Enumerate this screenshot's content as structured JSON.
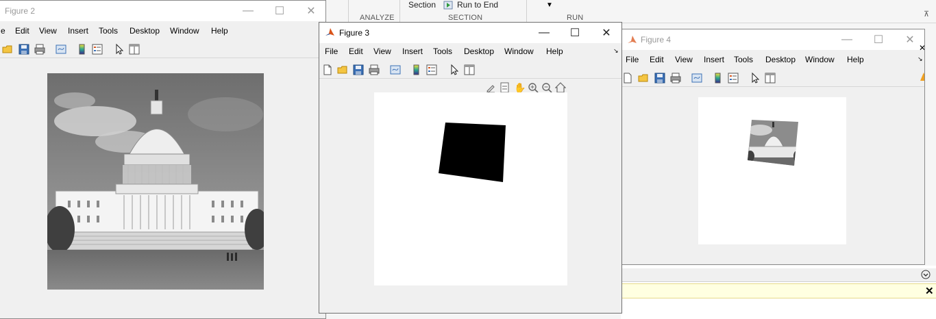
{
  "toolstrip": {
    "section_button": "Section",
    "run_to_end_button": "Run to End",
    "groups": {
      "analyze": "ANALYZE",
      "section": "SECTION",
      "run": "RUN"
    }
  },
  "figure2": {
    "title": "Figure 2",
    "menu": [
      "e",
      "Edit",
      "View",
      "Insert",
      "Tools",
      "Desktop",
      "Window",
      "Help"
    ]
  },
  "figure3": {
    "title": "Figure 3",
    "menu": [
      "File",
      "Edit",
      "View",
      "Insert",
      "Tools",
      "Desktop",
      "Window",
      "Help"
    ]
  },
  "figure4": {
    "title": "Figure 4",
    "menu": [
      "File",
      "Edit",
      "View",
      "Insert",
      "Tools",
      "Desktop",
      "Window",
      "Help"
    ]
  },
  "icons": {
    "window_controls": [
      "minimize-icon",
      "maximize-icon",
      "close-icon"
    ],
    "toolbar": [
      "new-figure-icon",
      "open-file-icon",
      "save-icon",
      "print-icon",
      "link-plot-icon",
      "insert-colorbar-icon",
      "insert-legend-icon",
      "edit-plot-icon",
      "property-inspector-icon"
    ],
    "axes_toolbar": [
      "brush-icon",
      "data-tips-icon",
      "pan-icon",
      "zoom-in-icon",
      "zoom-out-icon",
      "home-icon"
    ]
  },
  "colors": {
    "matlab_orange": "#d95319",
    "warning_yellow": "#ffffe1"
  }
}
